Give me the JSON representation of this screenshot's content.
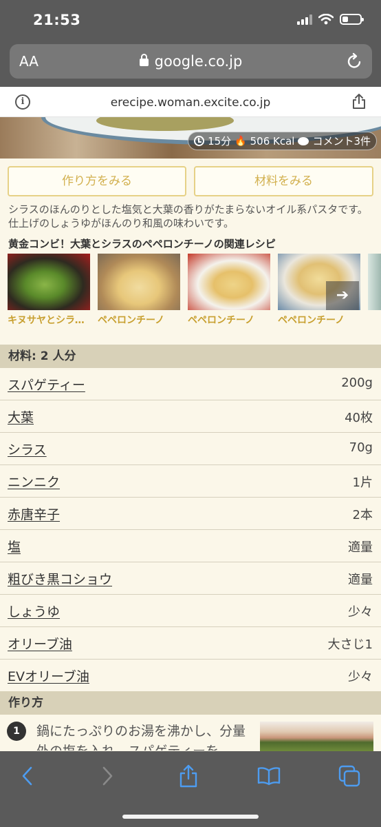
{
  "status_bar": {
    "time": "21:53"
  },
  "browser": {
    "aa_label": "AA",
    "url": "google.co.jp",
    "site_domain": "erecipe.woman.excite.co.jp"
  },
  "recipe": {
    "time": "15分",
    "calories": "506 Kcal",
    "comments": "コメント3件",
    "how_to_button": "作り方をみる",
    "ingredients_button": "材料をみる",
    "description": "シラスのほんのりとした塩気と大葉の香りがたまらないオイル系パスタです。仕上げのしょうゆがほんのり和風の味わいです。",
    "related_heading": "黄金コンビ！大葉とシラスのペペロンチーノの関連レシピ",
    "related": [
      {
        "label": "キヌサヤとシラスのペペロンチーノ"
      },
      {
        "label": "ペペロンチーノ"
      },
      {
        "label": "ペペロンチーノ"
      },
      {
        "label": "ペペロンチーノ"
      }
    ]
  },
  "ingredients": {
    "heading": "材料: 2 人分",
    "items": [
      {
        "name": "スパゲティー",
        "qty": "200g"
      },
      {
        "name": "大葉",
        "qty": "40枚"
      },
      {
        "name": "シラス",
        "qty": "70g"
      },
      {
        "name": "ニンニク",
        "qty": "1片"
      },
      {
        "name": "赤唐辛子",
        "qty": "2本"
      },
      {
        "name": "塩",
        "qty": "適量"
      },
      {
        "name": "粗びき黒コショウ",
        "qty": "適量"
      },
      {
        "name": "しょうゆ",
        "qty": "少々"
      },
      {
        "name": "オリーブ油",
        "qty": "大さじ1"
      },
      {
        "name": "EVオリーブ油",
        "qty": "少々"
      }
    ]
  },
  "steps": {
    "heading": "作り方",
    "items": [
      {
        "number": "1",
        "text": "鍋にたっぷりのお湯を沸かし、分量外の塩を入れ、スパゲティーを"
      }
    ]
  },
  "colors": {
    "chrome": "#5a5a5a",
    "page_bg": "#fbf7e9",
    "accent_gold": "#d2b04e",
    "section_bg": "#d8d1b8",
    "toolbar_icon": "#4d9cf0"
  }
}
